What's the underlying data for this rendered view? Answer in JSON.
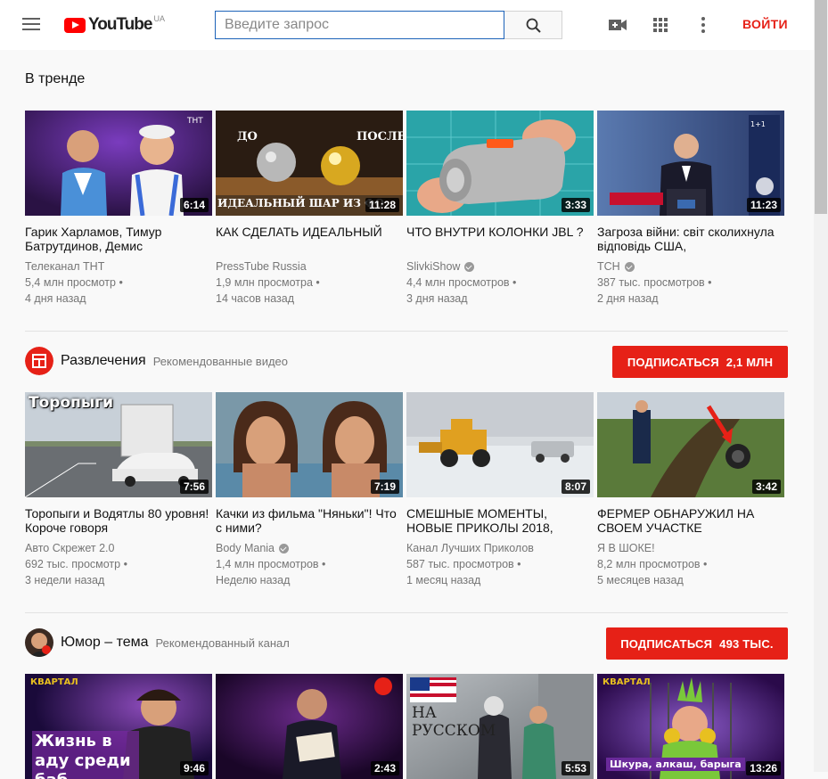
{
  "header": {
    "logo_text": "YouTube",
    "region": "UA",
    "search_placeholder": "Введите запрос",
    "signin_label": "ВОЙТИ"
  },
  "trending": {
    "title": "В тренде",
    "videos": [
      {
        "title": "Гарик Харламов, Тимур Батрутдинов, Демис",
        "channel": "Телеканал ТНТ",
        "verified": false,
        "views": "5,4 млн просмотр",
        "age": "4 дня назад",
        "duration": "6:14"
      },
      {
        "title": "КАК СДЕЛАТЬ ИДЕАЛЬНЫЙ",
        "channel": "PressTube Russia",
        "verified": false,
        "views": "1,9 млн просмотра",
        "age": "14 часов назад",
        "duration": "11:28",
        "thumb_top_left": "ДО",
        "thumb_top_right": "ПОСЛЕ",
        "thumb_bottom": "ИДЕАЛЬНЫЙ ШАР ИЗ ФО"
      },
      {
        "title": "ЧТО ВНУТРИ КОЛОНКИ JBL ?",
        "channel": "SlivkiShow",
        "verified": true,
        "views": "4,4 млн просмотров",
        "age": "3 дня назад",
        "duration": "3:33"
      },
      {
        "title": "Загроза війни: світ сколихнула відповідь США,",
        "channel": "ТСН",
        "verified": true,
        "views": "387 тыс. просмотров",
        "age": "2 дня назад",
        "duration": "11:23"
      }
    ]
  },
  "entertainment": {
    "name": "Развлечения",
    "subtitle": "Рекомендованные видео",
    "subscribe_label": "ПОДПИСАТЬСЯ",
    "subscribe_count": "2,1 МЛН",
    "videos": [
      {
        "title": "Торопыги и Водятлы 80 уровня! Короче говоря",
        "channel": "Авто Скрежет 2.0",
        "verified": false,
        "views": "692 тыс. просмотр",
        "age": "3 недели назад",
        "duration": "7:56",
        "thumb_caption": "Торопыги"
      },
      {
        "title": "Качки из фильма \"Няньки\"! Что с ними?",
        "channel": "Body Mania",
        "verified": true,
        "views": "1,4 млн просмотров",
        "age": "Неделю назад",
        "duration": "7:19"
      },
      {
        "title": "СМЕШНЫЕ МОМЕНТЫ, НОВЫЕ ПРИКОЛЫ 2018,",
        "channel": "Канал Лучших Приколов",
        "verified": false,
        "views": "587 тыс. просмотров",
        "age": "1 месяц назад",
        "duration": "8:07"
      },
      {
        "title": "ФЕРМЕР ОБНАРУЖИЛ НА СВОЕМ УЧАСТКЕ",
        "channel": "Я В ШОКЕ!",
        "verified": false,
        "views": "8,2 млн просмотров",
        "age": "5 месяцев назад",
        "duration": "3:42"
      }
    ]
  },
  "humor": {
    "name": "Юмор – тема",
    "subtitle": "Рекомендованный канал",
    "subscribe_label": "ПОДПИСАТЬСЯ",
    "subscribe_count": "493 ТЫС.",
    "videos": [
      {
        "duration": "9:46",
        "thumb_caption": "Жизнь в аду среди баб",
        "thumb_badge": "КВАРТАЛ"
      },
      {
        "duration": "2:43"
      },
      {
        "duration": "5:53",
        "thumb_caption": "НА РУССКОМ"
      },
      {
        "duration": "13:26",
        "thumb_caption": "Шкура, алкаш, барыга",
        "thumb_badge": "КВАРТАЛ"
      }
    ]
  },
  "colors": {
    "accent": "#e62117",
    "brand": "#ff0000",
    "meta": "#767676"
  }
}
